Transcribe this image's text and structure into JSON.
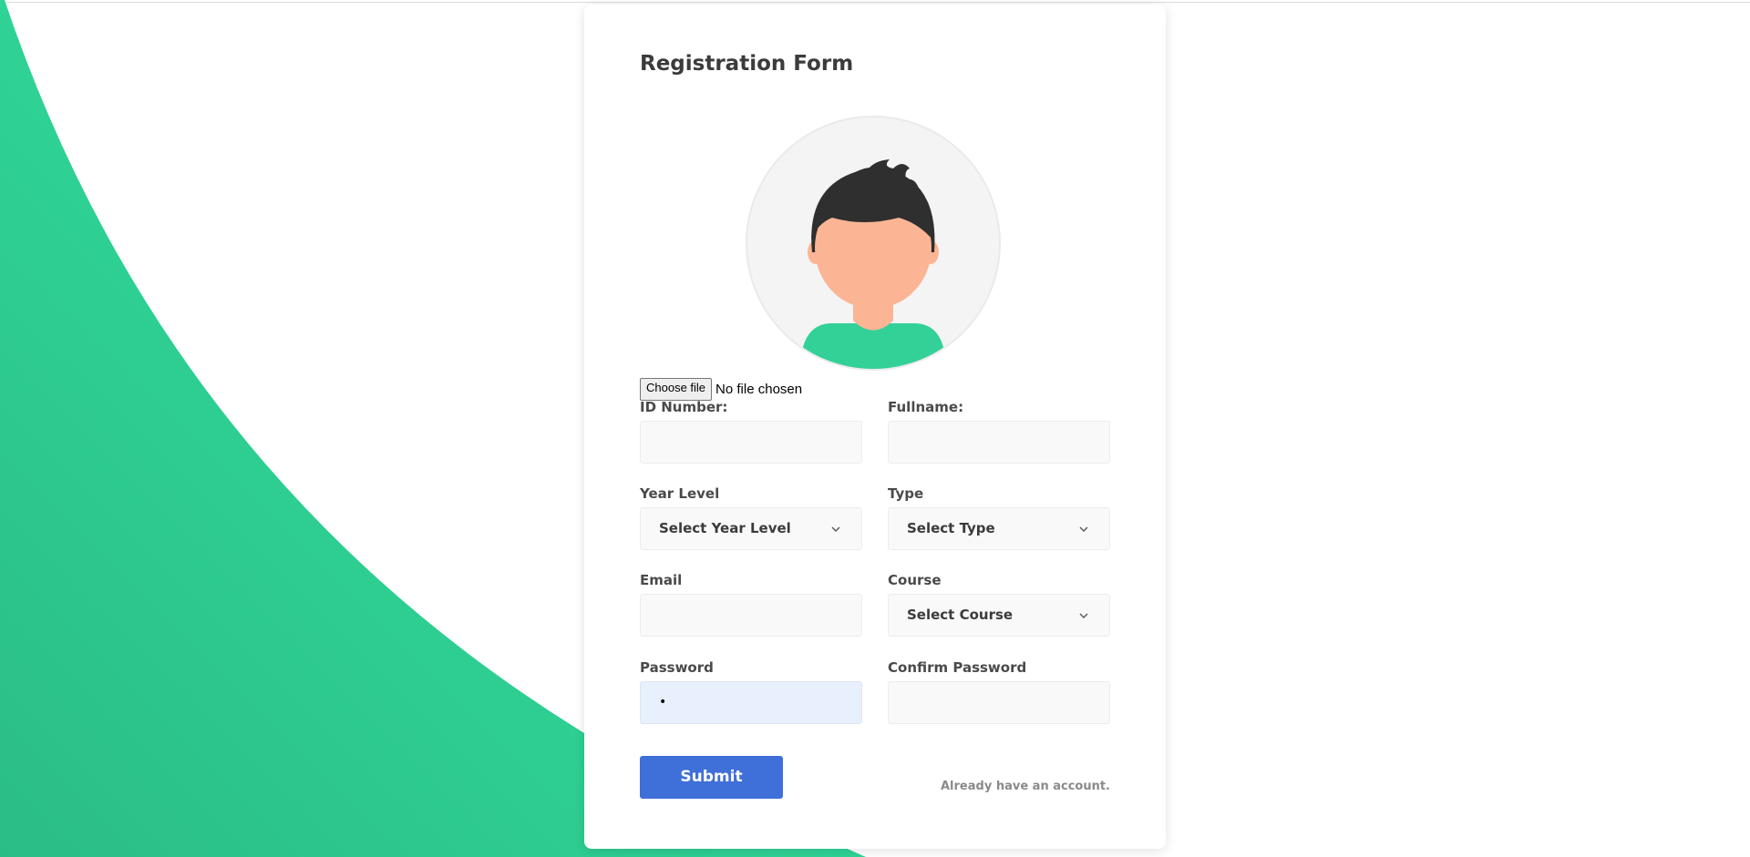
{
  "colors": {
    "accent_green": "#2fd395",
    "submit_blue": "#3f6fd8",
    "label_gray": "#4a4a4a",
    "input_bg": "#f9f9f9",
    "active_input_bg": "#e8f0fe"
  },
  "form": {
    "title": "Registration Form",
    "avatar": {
      "icon": "user-avatar-icon"
    },
    "file_input": {
      "button_label": "Choose file",
      "status": "No file chosen"
    },
    "fields": {
      "id_number": {
        "label": "ID Number:",
        "value": ""
      },
      "fullname": {
        "label": "Fullname:",
        "value": ""
      },
      "year_level": {
        "label": "Year Level",
        "selected": "Select Year Level"
      },
      "type": {
        "label": "Type",
        "selected": "Select Type"
      },
      "email": {
        "label": "Email",
        "value": ""
      },
      "course": {
        "label": "Course",
        "selected": "Select Course"
      },
      "password": {
        "label": "Password",
        "value": "•"
      },
      "confirm_password": {
        "label": "Confirm Password",
        "value": ""
      }
    },
    "submit_label": "Submit",
    "login_link": "Already have an account."
  }
}
